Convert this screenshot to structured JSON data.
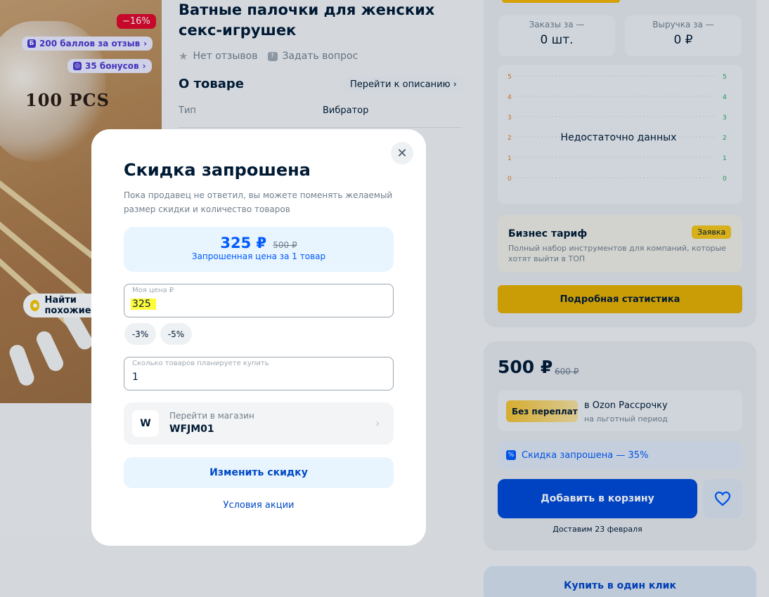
{
  "product": {
    "title": "Ватные палочки для женских секс-игрушек",
    "discount_badge": "−16%",
    "points_badge": "200 баллов за отзыв",
    "bonus_badge": "35 бонусов",
    "image_text": "100 PCS",
    "find_similar": "Найти похожие",
    "reviews": "Нет отзывов",
    "ask_question": "Задать вопрос",
    "about_title": "О товаре",
    "to_description": "Перейти к описанию",
    "spec_key": "Тип",
    "spec_value": "Вибратор"
  },
  "stats": {
    "orders_label": "Заказы за —",
    "orders_value": "0 шт.",
    "revenue_label": "Выручка за —",
    "revenue_value": "0 ₽",
    "no_data": "Недостаточно данных",
    "business_title": "Бизнес тариф",
    "business_badge": "Заявка",
    "business_desc": "Полный набор инструментов для компаний, которые хотят выйти в ТОП",
    "stats_button": "Подробная статистика"
  },
  "chart_data": {
    "type": "line",
    "left_ticks": [
      "5",
      "4",
      "3",
      "2",
      "1",
      "0"
    ],
    "right_ticks": [
      "5",
      "4",
      "3",
      "2",
      "1",
      "0"
    ],
    "left_color": "#e07a1f",
    "right_color": "#1fa85a",
    "series": [],
    "annotation": "Недостаточно данных"
  },
  "purchase": {
    "price": "500 ₽",
    "old_price": "600 ₽",
    "installment_badge": "Без переплат",
    "installment_line1": "в Ozon Рассрочку",
    "installment_line2": "на льготный период",
    "discount_requested": "Скидка запрошена — 35%",
    "add_to_cart": "Добавить в корзину",
    "delivery": "Доставим 23 февраля",
    "buy_one_click": "Купить в один клик"
  },
  "modal": {
    "title": "Скидка запрошена",
    "subtitle": "Пока продавец не ответил, вы можете поменять желаемый размер скидки и количество товаров",
    "requested_price": "325 ₽",
    "original_price": "500 ₽",
    "price_caption": "Запрошенная цена за 1 товар",
    "my_price_label": "Моя цена ₽",
    "my_price_value": "325",
    "chip_3": "-3%",
    "chip_5": "-5%",
    "qty_label": "Сколько товаров планируете купить",
    "qty_value": "1",
    "shop_avatar": "W",
    "shop_link": "Перейти в магазин",
    "shop_name": "WFJM01",
    "change_button": "Изменить скидку",
    "terms_link": "Условия акции"
  },
  "colors": {
    "brand_blue": "#005bff",
    "accent_yellow": "#f5c518",
    "sale_red": "#e2062a",
    "highlight": "#fffb3a"
  }
}
